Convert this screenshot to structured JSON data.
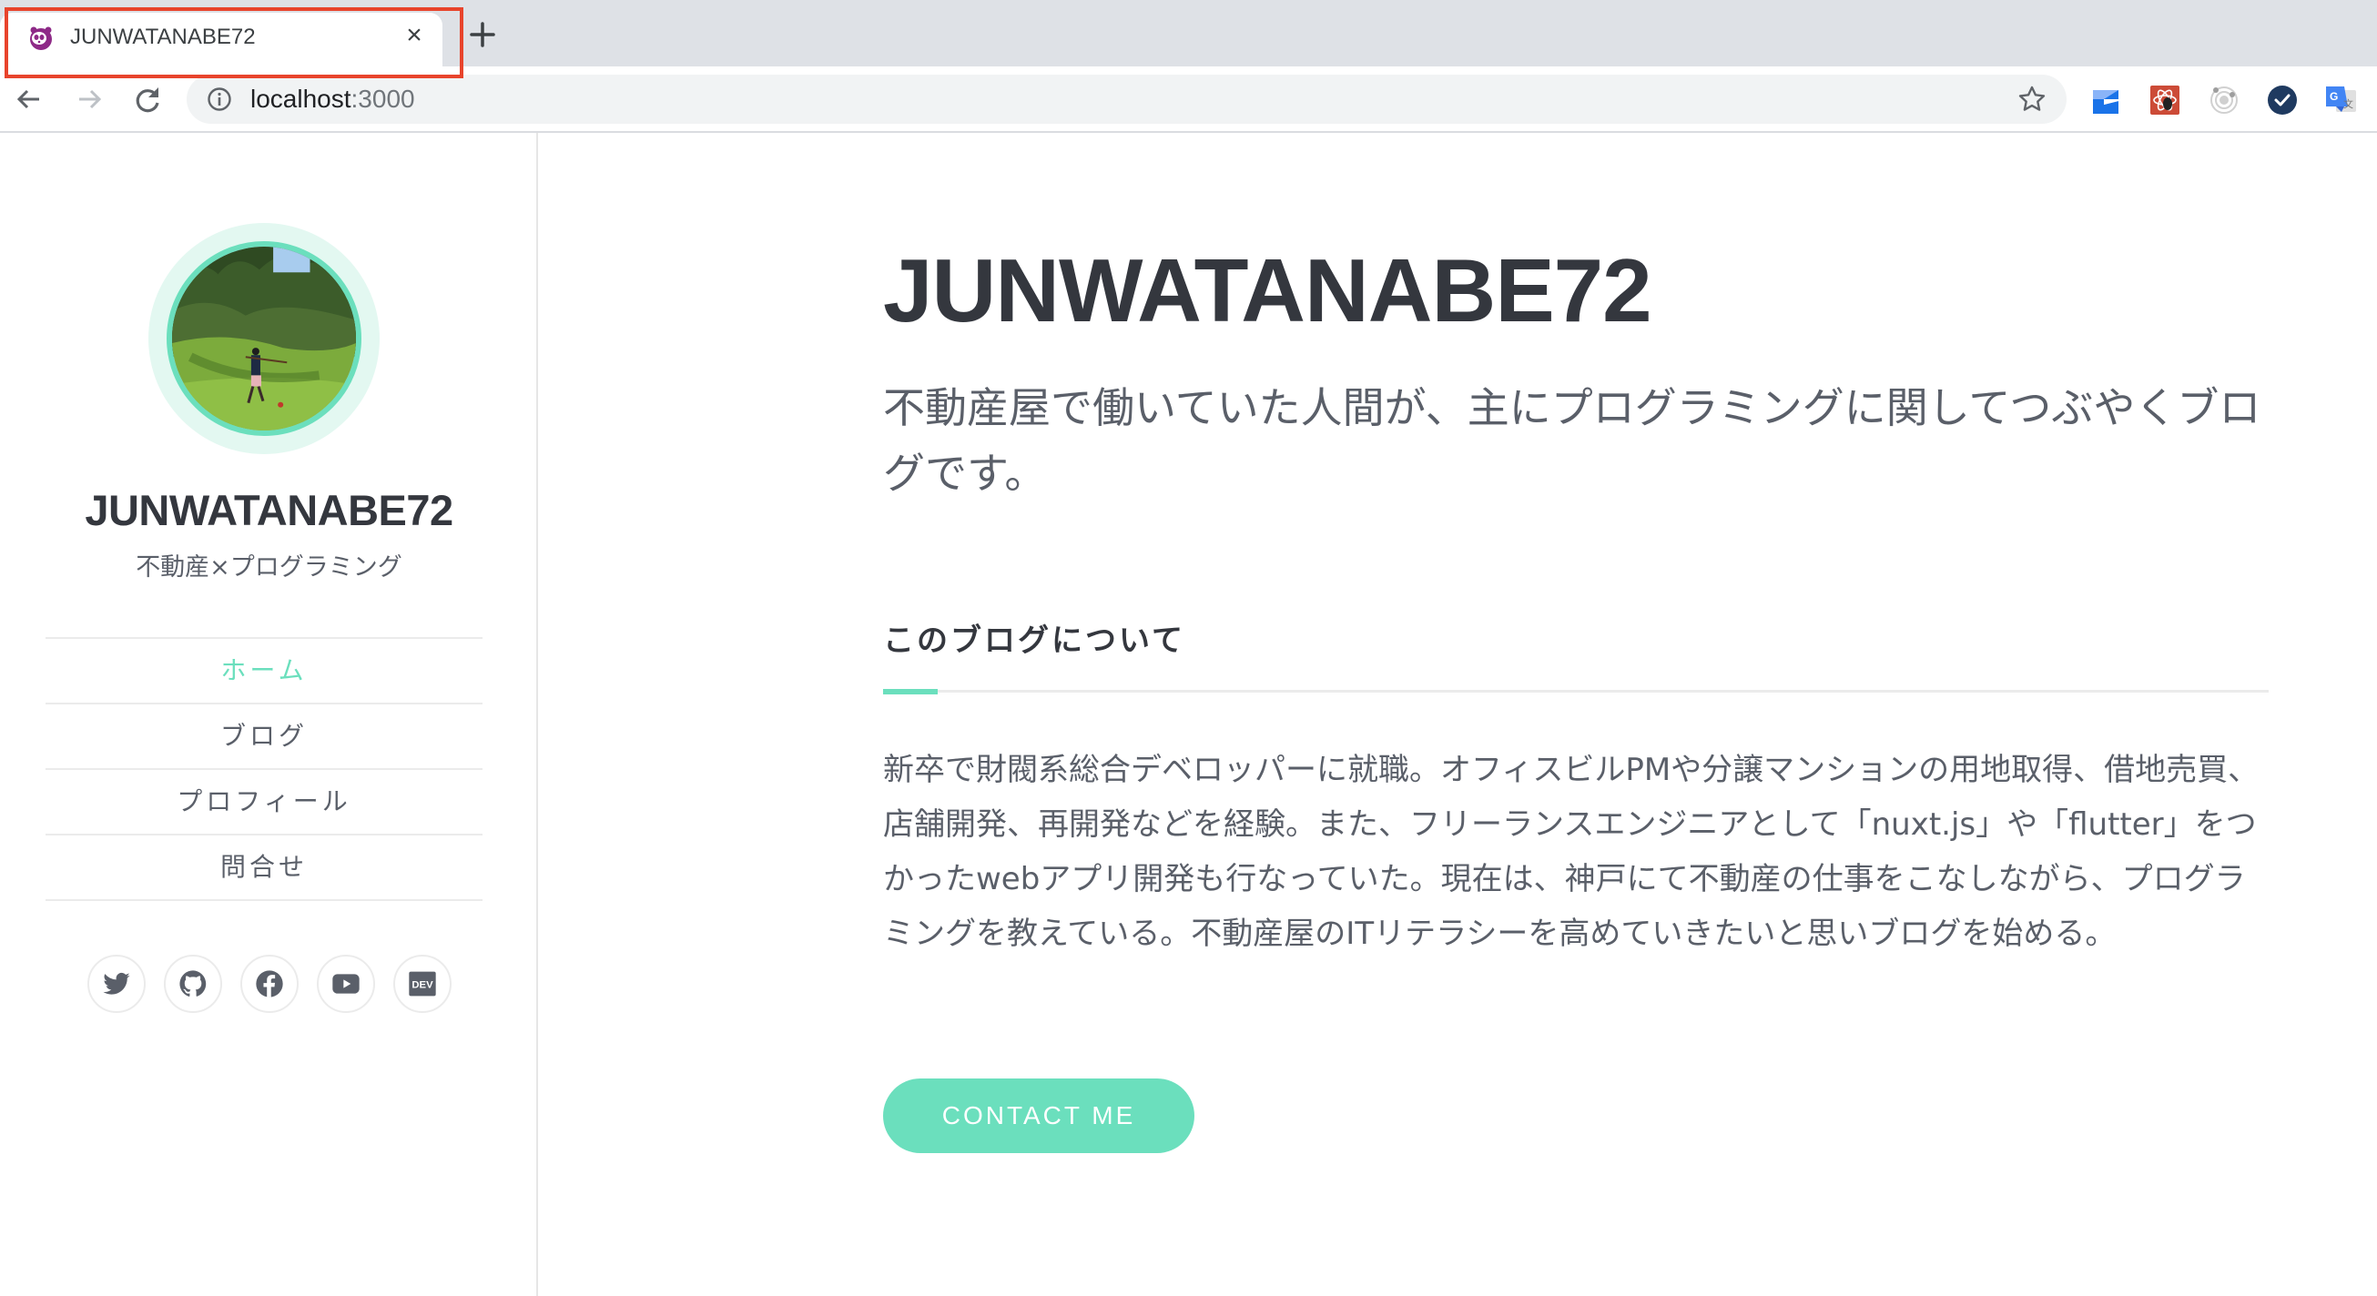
{
  "browser": {
    "tab": {
      "title": "JUNWATANABE72",
      "favicon": "panda-favicon-icon",
      "close_label": "×"
    },
    "new_tab_icon": "plus-icon",
    "nav": {
      "back_icon": "arrow-left-icon",
      "forward_icon": "arrow-right-icon",
      "reload_icon": "reload-icon"
    },
    "address_bar": {
      "host": "localhost",
      "port": ":3000",
      "security_icon": "info-icon",
      "bookmark_icon": "star-icon"
    },
    "extensions": [
      {
        "name": "blue-g-extension-icon",
        "color": "#1a73e8"
      },
      {
        "name": "atom-bug-extension-icon",
        "color": "#cc4b37"
      },
      {
        "name": "gray-orbit-extension-icon",
        "color": "#bdbdbd"
      },
      {
        "name": "checkmark-extension-icon",
        "color": "#1f3a60"
      },
      {
        "name": "google-translate-extension-icon",
        "color": "#4285f4"
      }
    ],
    "highlight_color": "#e8442c"
  },
  "sidebar": {
    "name": "JUNWATANABE72",
    "tagline": "不動産×プログラミング",
    "nav": [
      {
        "label": "ホーム",
        "active": true
      },
      {
        "label": "ブログ",
        "active": false
      },
      {
        "label": "プロフィール",
        "active": false
      },
      {
        "label": "問合せ",
        "active": false
      }
    ],
    "socials": [
      {
        "name": "twitter-icon"
      },
      {
        "name": "github-icon"
      },
      {
        "name": "facebook-icon"
      },
      {
        "name": "youtube-icon"
      },
      {
        "name": "dev-icon",
        "label": "DEV"
      }
    ]
  },
  "main": {
    "title": "JUNWATANABE72",
    "tagline": "不動産屋で働いていた人間が、主にプログラミングに関してつぶやくブログです。",
    "about": {
      "heading": "このブログについて",
      "body": "新卒で財閥系総合デベロッパーに就職。オフィスビルPMや分譲マンションの用地取得、借地売買、店舗開発、再開発などを経験。また、フリーランスエンジニアとして「nuxt.js」や「flutter」をつかったwebアプリ開発も行なっていた。現在は、神戸にて不動産の仕事をこなしながら、プログラミングを教えている。不動産屋のITリテラシーを高めていきたいと思いブログを始める。"
    },
    "contact_button": "CONTACT ME"
  },
  "theme": {
    "accent": "#6bdfbd",
    "accent_light": "#e3f8f1",
    "text_dark": "#34373e",
    "text_muted": "#5a5f69",
    "divider": "#ebebeb"
  }
}
